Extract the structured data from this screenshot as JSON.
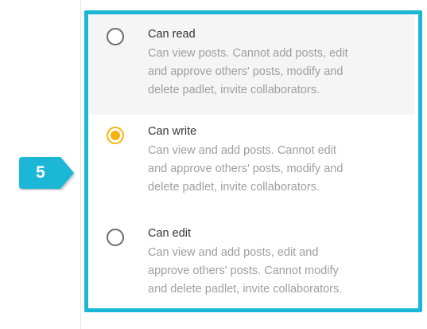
{
  "permissions": {
    "options": [
      {
        "title": "Can read",
        "description_lines": [
          "Can view posts. Cannot add posts, edit",
          "and approve others' posts, modify and",
          "delete padlet, invite collaborators."
        ],
        "selected": false
      },
      {
        "title": "Can write",
        "description_lines": [
          "Can view and add posts. Cannot edit",
          "and approve others' posts, modify and",
          "delete padlet, invite collaborators."
        ],
        "selected": true
      },
      {
        "title": "Can edit",
        "description_lines": [
          "Can view and add posts, edit and",
          "approve others' posts. Cannot modify",
          "and delete padlet, invite collaborators."
        ],
        "selected": false
      }
    ]
  },
  "callout": {
    "label": "5"
  },
  "colors": {
    "highlight_border": "#1ab7d6",
    "callout_fill": "#1ab7d6",
    "radio_selected": "#f6b20b",
    "radio_unselected": "#6b6b6b",
    "hover_background": "#f5f5f5",
    "title_text": "#333333",
    "description_text": "#9e9e9e"
  }
}
